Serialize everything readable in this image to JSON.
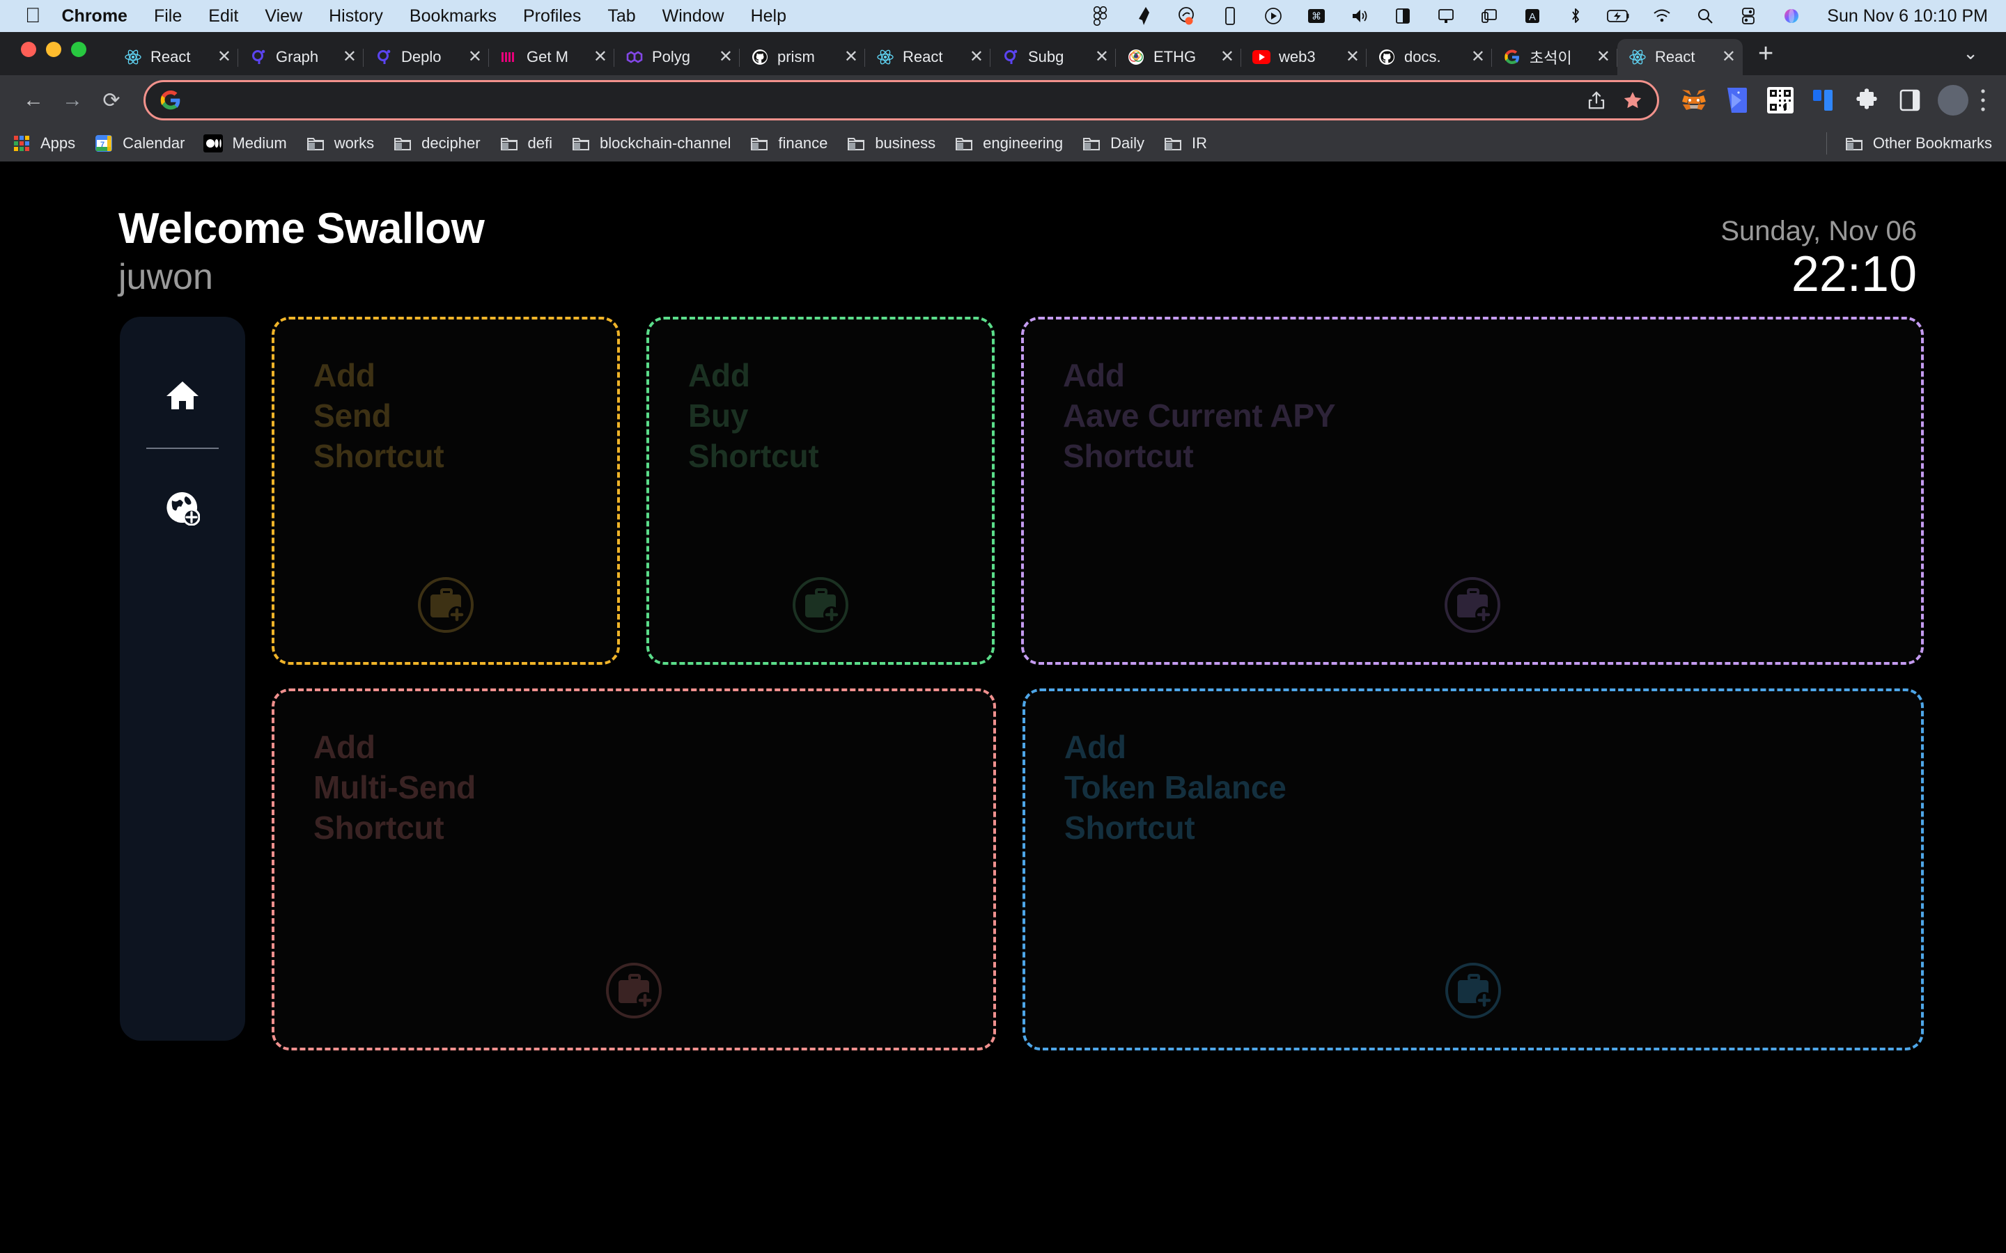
{
  "menubar": {
    "apple_icon": "apple-icon",
    "items": [
      {
        "label": "Chrome",
        "bold": true
      },
      {
        "label": "File",
        "bold": false
      },
      {
        "label": "Edit",
        "bold": false
      },
      {
        "label": "View",
        "bold": false
      },
      {
        "label": "History",
        "bold": false
      },
      {
        "label": "Bookmarks",
        "bold": false
      },
      {
        "label": "Profiles",
        "bold": false
      },
      {
        "label": "Tab",
        "bold": false
      },
      {
        "label": "Window",
        "bold": false
      },
      {
        "label": "Help",
        "bold": false
      }
    ],
    "status_icons": [
      "figma-icon",
      "rocket-icon",
      "shazam-icon",
      "mobile-icon",
      "play-circle-icon",
      "command-icon",
      "volume-icon",
      "split-view-icon",
      "display-icon",
      "screen-mirror-icon",
      "input-source-a-icon",
      "bluetooth-icon",
      "battery-charging-icon",
      "wifi-icon",
      "spotlight-search-icon",
      "control-center-icon",
      "siri-icon"
    ],
    "clock": "Sun Nov 6  10:10 PM"
  },
  "browser": {
    "window_controls": [
      "close",
      "minimize",
      "zoom"
    ],
    "tabs": [
      {
        "title": "React",
        "favicon": "react-icon",
        "active": false
      },
      {
        "title": "Graph",
        "favicon": "graph-icon",
        "active": false
      },
      {
        "title": "Deplo",
        "favicon": "graph-icon",
        "active": false
      },
      {
        "title": "Get M",
        "favicon": "medium-m-icon",
        "active": false
      },
      {
        "title": "Polyg",
        "favicon": "polygon-icon",
        "active": false
      },
      {
        "title": "prism",
        "favicon": "github-icon",
        "active": false
      },
      {
        "title": "React",
        "favicon": "react-icon",
        "active": false
      },
      {
        "title": "Subg",
        "favicon": "graph-icon",
        "active": false
      },
      {
        "title": "ETHG",
        "favicon": "ethglobal-icon",
        "active": false
      },
      {
        "title": "web3",
        "favicon": "youtube-icon",
        "active": false
      },
      {
        "title": "docs.",
        "favicon": "github-icon",
        "active": false
      },
      {
        "title": "초석이",
        "favicon": "google-icon",
        "active": false
      },
      {
        "title": "React",
        "favicon": "react-icon",
        "active": true
      }
    ],
    "new_tab_label": "+",
    "tab_search_label": "⌄",
    "close_label": "✕",
    "toolbar": {
      "back_label": "←",
      "forward_label": "→",
      "reload_label": "⟳",
      "omnibox_value": "",
      "omnibox_placeholder": "",
      "share_label": "share-icon",
      "bookmark_star_label": "★",
      "extensions": [
        "metamask-icon",
        "keplr-icon",
        "qr-code-icon",
        "blue-panel-icon",
        "puzzle-extensions-icon",
        "side-panel-icon"
      ],
      "profile_label": "avatar",
      "menu_label": "⋮"
    },
    "bookmarks": [
      {
        "label": "Apps",
        "icon": "apps-grid-icon"
      },
      {
        "label": "Calendar",
        "icon": "google-calendar-icon"
      },
      {
        "label": "Medium",
        "icon": "medium-icon"
      },
      {
        "label": "works",
        "icon": "folder-icon"
      },
      {
        "label": "decipher",
        "icon": "folder-icon"
      },
      {
        "label": "defi",
        "icon": "folder-icon"
      },
      {
        "label": "blockchain-channel",
        "icon": "folder-icon"
      },
      {
        "label": "finance",
        "icon": "folder-icon"
      },
      {
        "label": "business",
        "icon": "folder-icon"
      },
      {
        "label": "engineering",
        "icon": "folder-icon"
      },
      {
        "label": "Daily",
        "icon": "folder-icon"
      },
      {
        "label": "IR",
        "icon": "folder-icon"
      }
    ],
    "other_bookmarks": {
      "label": "Other Bookmarks",
      "icon": "folder-icon"
    }
  },
  "app": {
    "greeting": "Welcome Swallow",
    "username": "juwon",
    "date": "Sunday, Nov 06",
    "time": "22:10",
    "sidebar": {
      "items": [
        {
          "name": "home",
          "icon": "home-icon"
        },
        {
          "name": "add-network",
          "icon": "globe-plus-icon"
        }
      ]
    },
    "cards": [
      {
        "title": "Add\nSend\nShortcut",
        "border_color": "#f0b429",
        "text_color": "#3d3114",
        "icon": "briefcase-plus-icon",
        "size": "small"
      },
      {
        "title": "Add\nBuy\nShortcut",
        "border_color": "#5bdd8a",
        "text_color": "#1b3122",
        "icon": "briefcase-plus-icon",
        "size": "small"
      },
      {
        "title": "Add\nAave Current APY\nShortcut",
        "border_color": "#c49bf0",
        "text_color": "#2d2338",
        "icon": "briefcase-plus-icon",
        "size": "wide"
      },
      {
        "title": "Add\nMulti-Send\nShortcut",
        "border_color": "#f0908e",
        "text_color": "#3a2323",
        "icon": "briefcase-plus-icon",
        "size": "mid"
      },
      {
        "title": "Add\nToken Balance\nShortcut",
        "border_color": "#4ea6e8",
        "text_color": "#14303f",
        "icon": "briefcase-plus-icon",
        "size": "wide2"
      }
    ]
  }
}
